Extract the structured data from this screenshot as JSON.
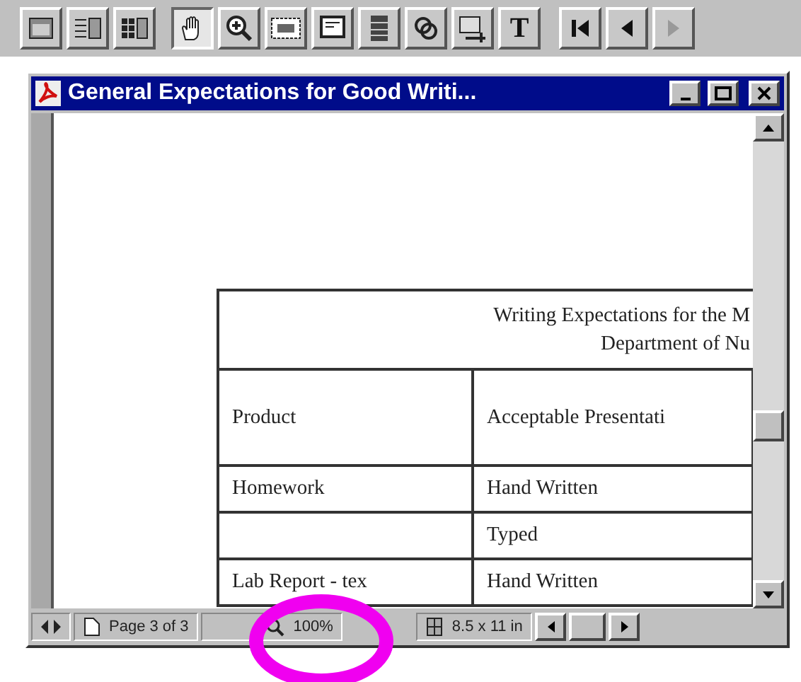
{
  "toolbar": {
    "text_button": "T",
    "tools": [
      {
        "kind": "icon",
        "selected": false
      },
      {
        "kind": "icon",
        "selected": false
      },
      {
        "kind": "icon",
        "selected": false
      },
      {
        "kind": "icon",
        "selected": true
      },
      {
        "kind": "icon",
        "selected": false
      },
      {
        "kind": "icon",
        "selected": false
      },
      {
        "kind": "icon",
        "selected": false
      },
      {
        "kind": "icon",
        "selected": false
      },
      {
        "kind": "icon",
        "selected": false
      },
      {
        "kind": "icon",
        "selected": false
      },
      {
        "kind": "text",
        "selected": false
      }
    ]
  },
  "window": {
    "title": "General Expectations for Good Writi..."
  },
  "document": {
    "table": {
      "title_lines": [
        "Writing Expectations for the M",
        "Department of Nu"
      ],
      "columns": [
        "Product",
        "Acceptable Presentati"
      ],
      "rows": [
        [
          "Homework",
          "Hand Written"
        ],
        [
          "",
          "Typed"
        ],
        [
          "Lab Report - tex",
          "Hand Written"
        ]
      ]
    }
  },
  "status_bar": {
    "page": "Page 3 of 3",
    "zoom": "100%",
    "page_size": "8.5 x 11 in"
  }
}
